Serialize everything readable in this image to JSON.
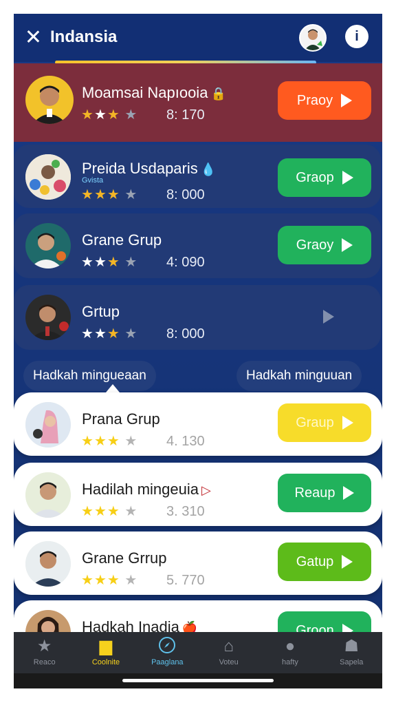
{
  "header": {
    "title": "Indansia",
    "close_icon": "close-icon",
    "info_label": "i"
  },
  "groups": [
    {
      "name": "Moamsai Napıooia",
      "name_icon": "🔒",
      "stars": [
        "gold",
        "white",
        "gold",
        "gray"
      ],
      "score": "8:  170",
      "button": "Praoy"
    },
    {
      "name": "Preida Usdaparis",
      "subtag": "Gvista",
      "name_icon": "💧",
      "stars": [
        "gold",
        "gold",
        "gold",
        "gray"
      ],
      "score": "8:  000",
      "button": "Graop"
    },
    {
      "name": "Grane Grup",
      "stars": [
        "white",
        "white",
        "gold",
        "gray"
      ],
      "score": "4:  090",
      "button": "Graoy"
    },
    {
      "name": "Grtup",
      "stars": [
        "white",
        "white",
        "gold",
        "gray"
      ],
      "score": "8:  000",
      "button": ""
    },
    {
      "name": "Prana Grup",
      "stars": [
        "gold",
        "gold",
        "gold",
        "gray"
      ],
      "score": "4.  130",
      "button": "Graup"
    },
    {
      "name": "Hadilah mingeuia",
      "name_icon": "▷",
      "stars": [
        "gold",
        "gold",
        "gold",
        "gray"
      ],
      "score": "3.  310",
      "button": "Reaup"
    },
    {
      "name": "Grane Grrup",
      "stars": [
        "gold",
        "gold",
        "gold",
        "gray"
      ],
      "score": "5.  770",
      "button": "Gatup"
    },
    {
      "name": "Hadkah Inadia",
      "name_icon": "🍎",
      "stars": [],
      "score": "",
      "button": "Groon"
    }
  ],
  "pills": [
    "Hadkah mingueaan",
    "Hadkah minguuan"
  ],
  "tabs": [
    {
      "label": "Reaco",
      "icon": "star-icon"
    },
    {
      "label": "Coolnite",
      "icon": "shop-icon"
    },
    {
      "label": "Paaglana",
      "icon": "compass-icon"
    },
    {
      "label": "Voteu",
      "icon": "house-icon"
    },
    {
      "label": "hafty",
      "icon": "chat-icon"
    },
    {
      "label": "Sapela",
      "icon": "people-icon"
    }
  ],
  "colors": {
    "accent_orange": "#ff5a1f",
    "accent_green": "#21b25c",
    "accent_yellow": "#f7dc2a",
    "accent_lime": "#5dbb1a",
    "bg_blue": "#16357b"
  }
}
